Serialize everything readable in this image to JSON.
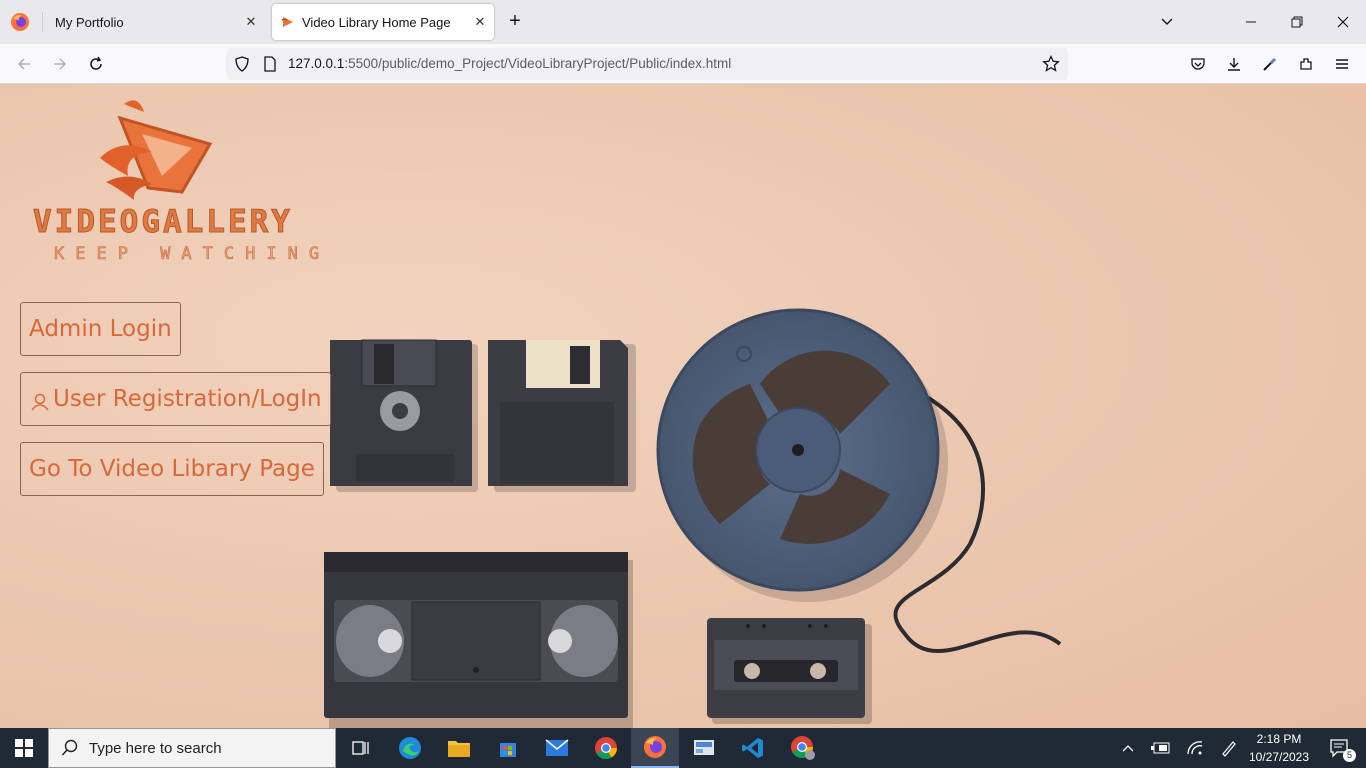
{
  "browser": {
    "tabs": [
      {
        "title": "My Portfolio",
        "active": false
      },
      {
        "title": "Video Library Home Page",
        "active": true
      }
    ],
    "url": {
      "host": "127.0.0.1",
      "rest": ":5500/public/demo_Project/VideoLibraryProject/Public/index.html"
    }
  },
  "page": {
    "brand": {
      "title": "VIDEOGALLERY",
      "tagline": "KEEP WATCHING"
    },
    "buttons": {
      "admin": "Admin Login",
      "user": "User Registration/LogIn",
      "library": "Go To Video Library Page"
    },
    "accent_color": "#d8683a",
    "background_color": "#ecc8b0"
  },
  "taskbar": {
    "search_placeholder": "Type here to search",
    "time": "2:18 PM",
    "date": "10/27/2023",
    "notification_count": "5"
  }
}
